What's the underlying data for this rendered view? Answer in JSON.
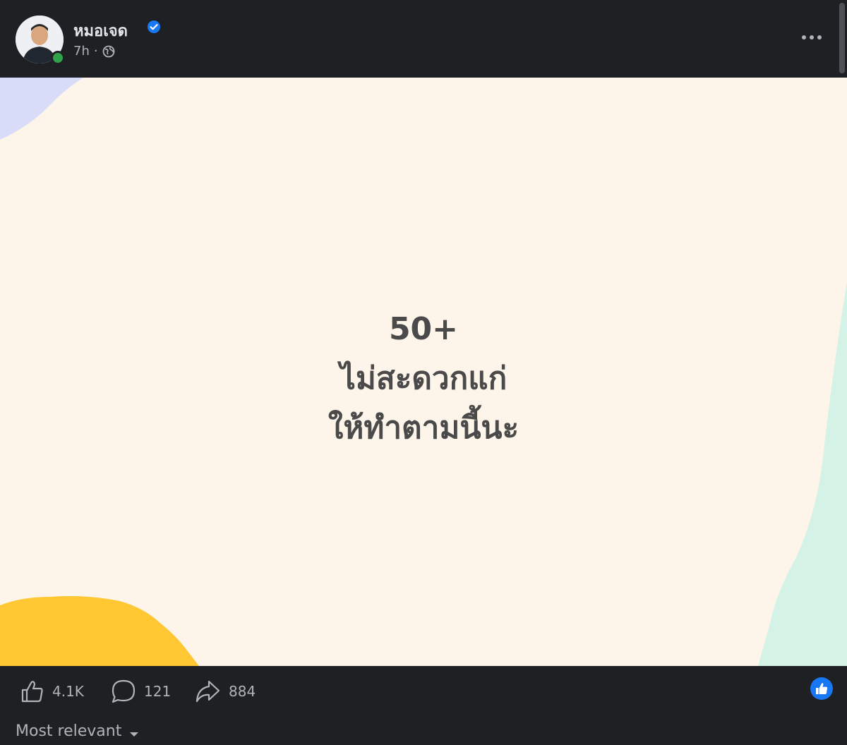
{
  "post": {
    "author": "หมอเจด",
    "verified": true,
    "time": "7h",
    "separator": "·",
    "privacy_icon": "globe-icon",
    "more_icon": "more-options-icon"
  },
  "image_text": {
    "line1": "50+",
    "line2": "ไม่สะดวกแก่",
    "line3": "ให้ทำตามนี้นะ"
  },
  "colors": {
    "image_background": "#fdf5ea",
    "blob_lavender": "#d8dcf9",
    "blob_yellow": "#ffc832",
    "blob_mint": "#d5f2e6",
    "text": "#4a4a4a",
    "accent": "#1877f2"
  },
  "actions": {
    "likes": "4.1K",
    "comments": "121",
    "shares": "884"
  },
  "comments": {
    "sort_label": "Most relevant"
  }
}
